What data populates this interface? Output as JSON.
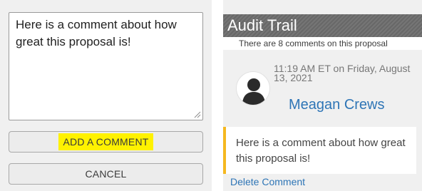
{
  "comment_form": {
    "textarea_value": "Here is a comment about how great this proposal is!",
    "add_button_label": "ADD A COMMENT",
    "cancel_button_label": "CANCEL",
    "highlight_color": "#fff200"
  },
  "audit_trail": {
    "title": "Audit Trail",
    "count_text": "There are 8 comments on this proposal",
    "entry": {
      "timestamp": "11:19 AM ET on Friday, August 13, 2021",
      "author": "Meagan Crews",
      "comment": "Here is a comment about how great this proposal is!",
      "delete_label": "Delete Comment",
      "avatar_icon": "user-silhouette-icon"
    },
    "accent_color": "#f5b820",
    "link_color": "#2e75b6"
  }
}
